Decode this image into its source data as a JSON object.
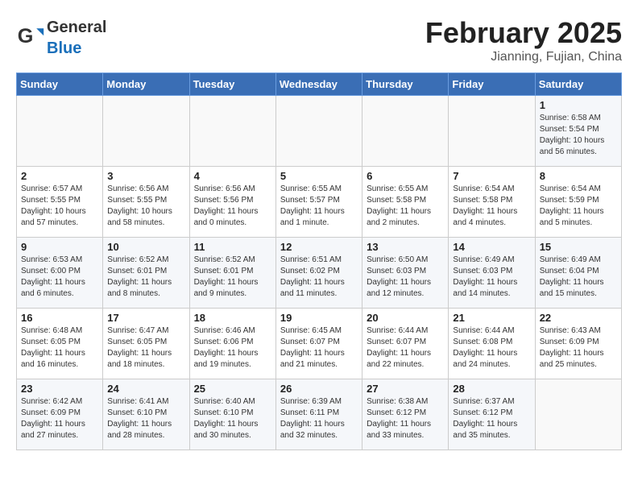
{
  "header": {
    "logo_general": "General",
    "logo_blue": "Blue",
    "month_title": "February 2025",
    "location": "Jianning, Fujian, China"
  },
  "days_of_week": [
    "Sunday",
    "Monday",
    "Tuesday",
    "Wednesday",
    "Thursday",
    "Friday",
    "Saturday"
  ],
  "weeks": [
    [
      {
        "day": "",
        "text": ""
      },
      {
        "day": "",
        "text": ""
      },
      {
        "day": "",
        "text": ""
      },
      {
        "day": "",
        "text": ""
      },
      {
        "day": "",
        "text": ""
      },
      {
        "day": "",
        "text": ""
      },
      {
        "day": "1",
        "text": "Sunrise: 6:58 AM\nSunset: 5:54 PM\nDaylight: 10 hours and 56 minutes."
      }
    ],
    [
      {
        "day": "2",
        "text": "Sunrise: 6:57 AM\nSunset: 5:55 PM\nDaylight: 10 hours and 57 minutes."
      },
      {
        "day": "3",
        "text": "Sunrise: 6:56 AM\nSunset: 5:55 PM\nDaylight: 10 hours and 58 minutes."
      },
      {
        "day": "4",
        "text": "Sunrise: 6:56 AM\nSunset: 5:56 PM\nDaylight: 11 hours and 0 minutes."
      },
      {
        "day": "5",
        "text": "Sunrise: 6:55 AM\nSunset: 5:57 PM\nDaylight: 11 hours and 1 minute."
      },
      {
        "day": "6",
        "text": "Sunrise: 6:55 AM\nSunset: 5:58 PM\nDaylight: 11 hours and 2 minutes."
      },
      {
        "day": "7",
        "text": "Sunrise: 6:54 AM\nSunset: 5:58 PM\nDaylight: 11 hours and 4 minutes."
      },
      {
        "day": "8",
        "text": "Sunrise: 6:54 AM\nSunset: 5:59 PM\nDaylight: 11 hours and 5 minutes."
      }
    ],
    [
      {
        "day": "9",
        "text": "Sunrise: 6:53 AM\nSunset: 6:00 PM\nDaylight: 11 hours and 6 minutes."
      },
      {
        "day": "10",
        "text": "Sunrise: 6:52 AM\nSunset: 6:01 PM\nDaylight: 11 hours and 8 minutes."
      },
      {
        "day": "11",
        "text": "Sunrise: 6:52 AM\nSunset: 6:01 PM\nDaylight: 11 hours and 9 minutes."
      },
      {
        "day": "12",
        "text": "Sunrise: 6:51 AM\nSunset: 6:02 PM\nDaylight: 11 hours and 11 minutes."
      },
      {
        "day": "13",
        "text": "Sunrise: 6:50 AM\nSunset: 6:03 PM\nDaylight: 11 hours and 12 minutes."
      },
      {
        "day": "14",
        "text": "Sunrise: 6:49 AM\nSunset: 6:03 PM\nDaylight: 11 hours and 14 minutes."
      },
      {
        "day": "15",
        "text": "Sunrise: 6:49 AM\nSunset: 6:04 PM\nDaylight: 11 hours and 15 minutes."
      }
    ],
    [
      {
        "day": "16",
        "text": "Sunrise: 6:48 AM\nSunset: 6:05 PM\nDaylight: 11 hours and 16 minutes."
      },
      {
        "day": "17",
        "text": "Sunrise: 6:47 AM\nSunset: 6:05 PM\nDaylight: 11 hours and 18 minutes."
      },
      {
        "day": "18",
        "text": "Sunrise: 6:46 AM\nSunset: 6:06 PM\nDaylight: 11 hours and 19 minutes."
      },
      {
        "day": "19",
        "text": "Sunrise: 6:45 AM\nSunset: 6:07 PM\nDaylight: 11 hours and 21 minutes."
      },
      {
        "day": "20",
        "text": "Sunrise: 6:44 AM\nSunset: 6:07 PM\nDaylight: 11 hours and 22 minutes."
      },
      {
        "day": "21",
        "text": "Sunrise: 6:44 AM\nSunset: 6:08 PM\nDaylight: 11 hours and 24 minutes."
      },
      {
        "day": "22",
        "text": "Sunrise: 6:43 AM\nSunset: 6:09 PM\nDaylight: 11 hours and 25 minutes."
      }
    ],
    [
      {
        "day": "23",
        "text": "Sunrise: 6:42 AM\nSunset: 6:09 PM\nDaylight: 11 hours and 27 minutes."
      },
      {
        "day": "24",
        "text": "Sunrise: 6:41 AM\nSunset: 6:10 PM\nDaylight: 11 hours and 28 minutes."
      },
      {
        "day": "25",
        "text": "Sunrise: 6:40 AM\nSunset: 6:10 PM\nDaylight: 11 hours and 30 minutes."
      },
      {
        "day": "26",
        "text": "Sunrise: 6:39 AM\nSunset: 6:11 PM\nDaylight: 11 hours and 32 minutes."
      },
      {
        "day": "27",
        "text": "Sunrise: 6:38 AM\nSunset: 6:12 PM\nDaylight: 11 hours and 33 minutes."
      },
      {
        "day": "28",
        "text": "Sunrise: 6:37 AM\nSunset: 6:12 PM\nDaylight: 11 hours and 35 minutes."
      },
      {
        "day": "",
        "text": ""
      }
    ]
  ]
}
